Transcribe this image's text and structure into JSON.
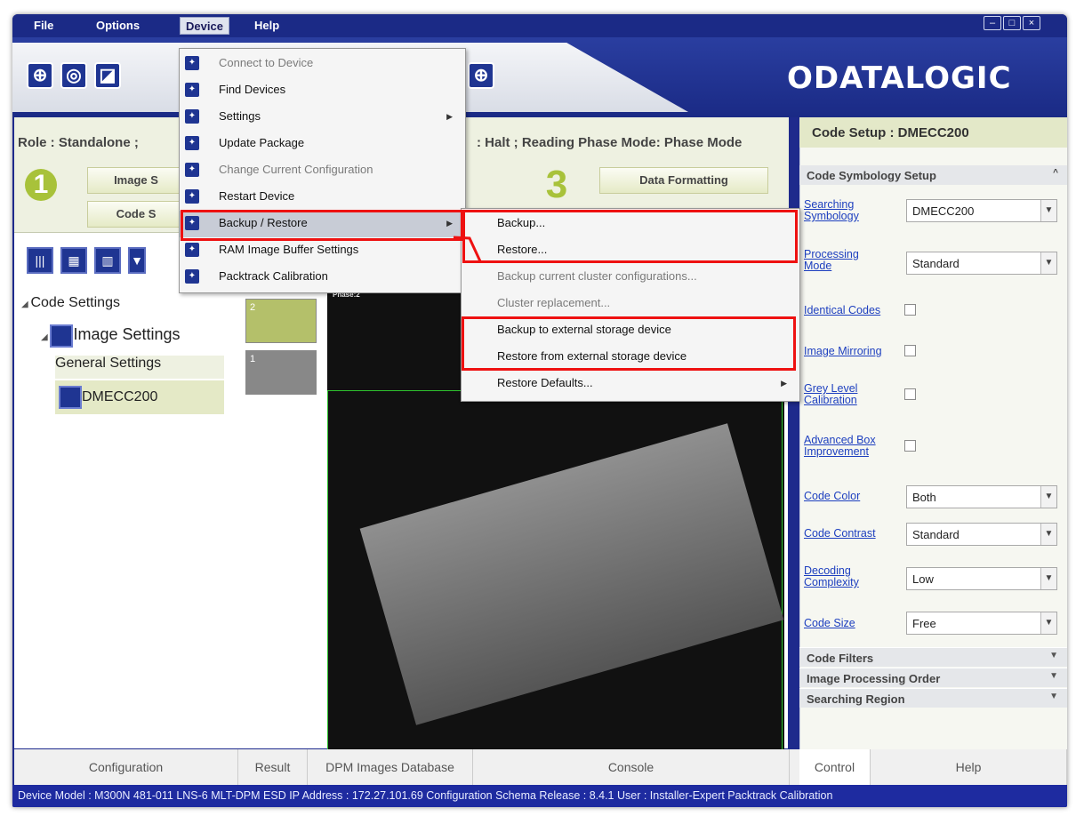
{
  "menubar": {
    "file": "File",
    "options": "Options",
    "device": "Device",
    "help": "Help"
  },
  "brand": {
    "logo": "ODATALOGIC"
  },
  "rolebar": {
    "role": "Role : Standalone ;",
    "status": ": Halt ; Reading Phase Mode: Phase Mode",
    "step1": "1",
    "step3": "3",
    "btn_image": "Image S",
    "btn_code": "Code S",
    "btn_formatting": "Data Formatting"
  },
  "tree": {
    "code_settings": "Code Settings",
    "image_settings": "Image Settings",
    "general_settings": "General Settings",
    "dmecc": "DMECC200"
  },
  "thumbs": {
    "t2": "2",
    "t1": "1",
    "phase": "Phase:2"
  },
  "device_menu": [
    {
      "label": "Connect to Device",
      "icon": "camera-icon",
      "disabled": true
    },
    {
      "label": "Find Devices",
      "icon": "find-icon"
    },
    {
      "label": "Settings",
      "icon": "wrench-icon",
      "submenu": true
    },
    {
      "label": "Update Package",
      "icon": "wrench-icon"
    },
    {
      "label": "Change Current Configuration",
      "icon": "wrench-icon",
      "disabled": true
    },
    {
      "label": "Restart Device",
      "icon": "restart-icon"
    },
    {
      "label": "Backup / Restore",
      "icon": "wrench-icon",
      "submenu": true,
      "highlighted": true
    },
    {
      "label": "RAM Image Buffer Settings",
      "icon": "wrench-icon"
    },
    {
      "label": "Packtrack Calibration",
      "icon": "crosshair-icon"
    }
  ],
  "backup_menu": [
    {
      "label": "Backup..."
    },
    {
      "label": "Restore..."
    },
    {
      "label": "Backup current cluster configurations...",
      "disabled": true
    },
    {
      "label": "Cluster replacement...",
      "disabled": true
    },
    {
      "label": "Backup to external storage device"
    },
    {
      "label": "Restore from external storage device"
    },
    {
      "label": "Restore Defaults...",
      "submenu": true
    }
  ],
  "right_panel": {
    "header": "Code Setup : DMECC200",
    "section": "Code Symbology Setup",
    "searching_symbology": "Searching Symbology",
    "searching_symbology_value": "DMECC200",
    "processing_mode": "Processing Mode",
    "processing_mode_value": "Standard",
    "identical_codes": "Identical Codes",
    "image_mirroring": "Image Mirroring",
    "grey_level": "Grey Level Calibration",
    "advanced_box": "Advanced Box Improvement",
    "code_color": "Code Color",
    "code_color_value": "Both",
    "code_contrast": "Code Contrast",
    "code_contrast_value": "Standard",
    "decoding_complexity": "Decoding Complexity",
    "decoding_complexity_value": "Low",
    "code_size": "Code Size",
    "code_size_value": "Free",
    "code_filters": "Code Filters",
    "image_processing_order": "Image Processing Order",
    "searching_region": "Searching Region"
  },
  "bottom_tabs": {
    "configuration": "Configuration",
    "result": "Result",
    "dpm": "DPM Images Database",
    "console": "Console",
    "control": "Control",
    "help": "Help"
  },
  "statusbar": "Device Model : M300N  481-011  LNS-6 MLT-DPM ESD  IP Address : 172.27.101.69  Configuration Schema Release : 8.4.1  User : Installer-Expert  Packtrack Calibration"
}
